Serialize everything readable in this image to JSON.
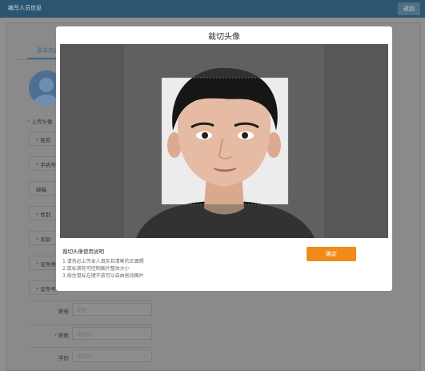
{
  "background": {
    "window_title": "编写人员信息",
    "top_button_label": "返回",
    "tab_label": "基本信息",
    "upload_label": "上传头像",
    "short_fields": [
      {
        "label": "姓名",
        "required": true
      },
      {
        "label": "手机号",
        "required": true
      },
      {
        "label": "邮箱",
        "required": false
      },
      {
        "label": "性别",
        "required": true
      },
      {
        "label": "年龄",
        "required": true
      },
      {
        "label": "证件类型",
        "required": true
      },
      {
        "label": "证件号",
        "required": true
      }
    ],
    "wide_fields": [
      {
        "label": "职务",
        "required": false,
        "placeholder": "职务",
        "select": false
      },
      {
        "label": "职称",
        "required": true,
        "placeholder": "请选择",
        "select": true
      },
      {
        "label": "学历",
        "required": false,
        "placeholder": "请选择",
        "select": true
      }
    ]
  },
  "modal": {
    "title": "裁切头像",
    "instructions_title": "裁切头像使用说明",
    "instructions": [
      "1.请务必上传本人真实且清晰的正面照",
      "2.鼠标滚轮可控制图片整体大小",
      "3.按住鼠标左键不放可以自由拖动图片"
    ],
    "confirm_label": "确定"
  },
  "colors": {
    "accent": "#f08a19",
    "header": "#2b5570",
    "required": "#b03030"
  },
  "icons": {
    "select_chevron": "chevron-down-icon",
    "avatar": "default-avatar-icon"
  }
}
